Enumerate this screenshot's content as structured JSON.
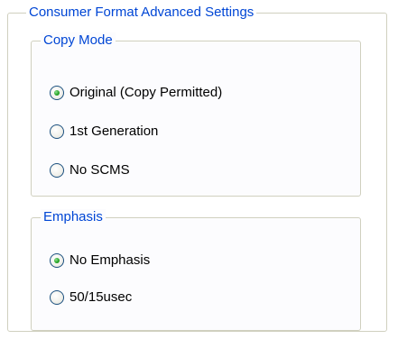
{
  "group": {
    "title": "Consumer Format Advanced Settings"
  },
  "copy_mode": {
    "title": "Copy Mode",
    "options": [
      {
        "label": "Original (Copy Permitted)",
        "checked": true
      },
      {
        "label": "1st Generation",
        "checked": false
      },
      {
        "label": "No SCMS",
        "checked": false
      }
    ]
  },
  "emphasis": {
    "title": "Emphasis",
    "options": [
      {
        "label": "No Emphasis",
        "checked": true
      },
      {
        "label": "50/15usec",
        "checked": false
      }
    ]
  },
  "colors": {
    "group_title": "#0046d5",
    "group_border": "#d0d0bf",
    "radio_checked": "#21a121"
  }
}
